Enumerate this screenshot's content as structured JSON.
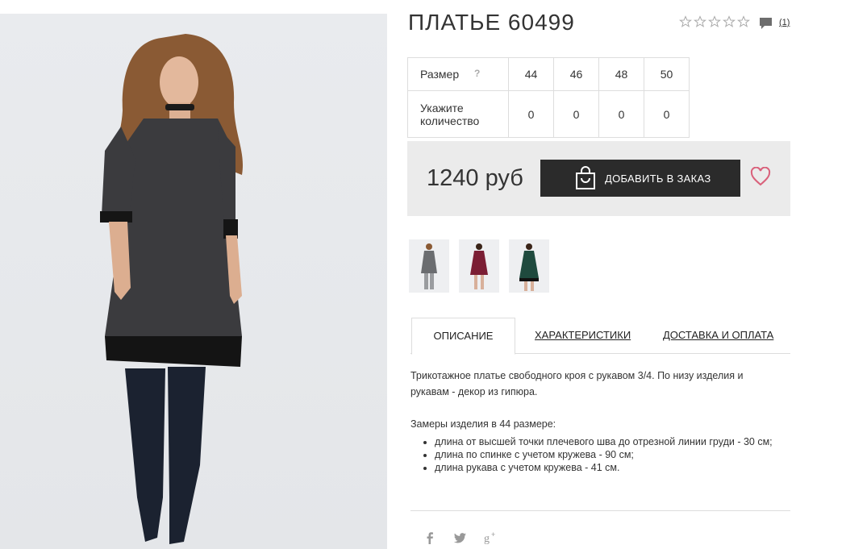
{
  "product": {
    "title": "ПЛАТЬЕ 60499",
    "rating_stars": 0,
    "rating_max": 5,
    "comment_count": "(1)",
    "price": "1240 руб",
    "add_to_order_label": "ДОБАВИТЬ В ЗАКАЗ"
  },
  "sizes": {
    "size_label": "Размер",
    "help_mark": "?",
    "qty_label_line1": "Укажите",
    "qty_label_line2": "количество",
    "items": [
      {
        "size": "44",
        "qty": "0"
      },
      {
        "size": "46",
        "qty": "0"
      },
      {
        "size": "48",
        "qty": "0"
      },
      {
        "size": "50",
        "qty": "0"
      }
    ]
  },
  "thumbnails": [
    {
      "color": "#6b6d70"
    },
    {
      "color": "#7b1e34"
    },
    {
      "color": "#1f4a3e"
    }
  ],
  "tabs": [
    {
      "label": "ОПИСАНИЕ",
      "active": true
    },
    {
      "label": "ХАРАКТЕРИСТИКИ",
      "active": false
    },
    {
      "label": "ДОСТАВКА И ОПЛАТА",
      "active": false
    }
  ],
  "description": {
    "text": "Трикотажное платье свободного кроя с рукавом 3/4. По низу изделия и рукавам - декор из гипюра.",
    "measurements_title": "Замеры изделия в 44 размере:",
    "measurements": [
      "длина от высшей точки плечевого шва до отрезной линии груди - 30 см;",
      "длина по спинке с учетом кружева - 90 см;",
      "длина рукава с учетом кружева - 41 см."
    ]
  },
  "social": [
    "facebook-icon",
    "twitter-icon",
    "google-plus-icon"
  ],
  "colors": {
    "button_bg": "#2b2b2b",
    "buybox_bg": "#ebebeb",
    "heart": "#d9607a"
  }
}
